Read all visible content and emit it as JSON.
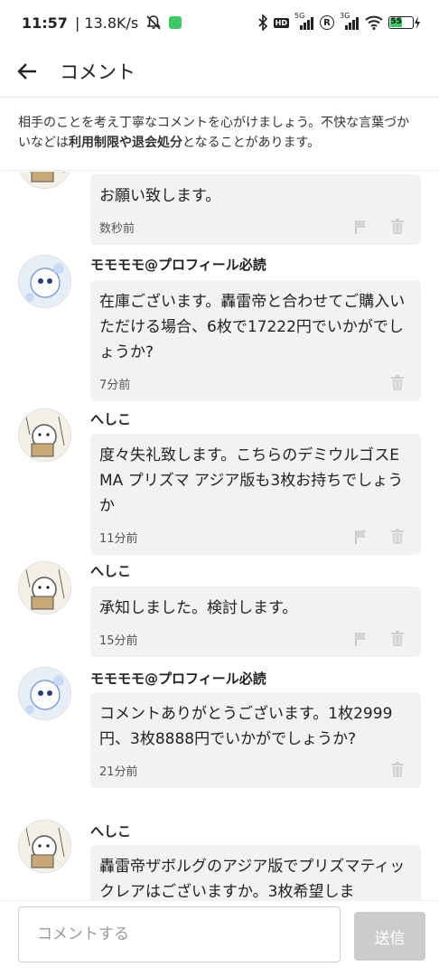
{
  "status_bar": {
    "time": "11:57",
    "speed": "| 13.8K/s",
    "battery": "55",
    "net1": "5G",
    "net2": "3G",
    "hd": "HD",
    "r": "R"
  },
  "header": {
    "title": "コメント"
  },
  "notice": {
    "text_1": "相手のことを考え丁寧なコメントを心がけましょう。不快な言葉づかいなどは",
    "text_bold": "利用制限や退会処分",
    "text_2": "となることがあります。"
  },
  "comments": [
    {
      "author": "",
      "text": "お願い致します。",
      "time": "数秒前",
      "flag": true,
      "delete": true
    },
    {
      "author": "モモモモ@プロフィール必読",
      "text": "在庫ございます。轟雷帝と合わせてご購入いただける場合、6枚で17222円でいかがでしょうか?",
      "time": "7分前",
      "flag": false,
      "delete": true
    },
    {
      "author": "へしこ",
      "text": "度々失礼致します。こちらのデミウルゴスEMA プリズマ アジア版も3枚お持ちでしょうか",
      "time": "11分前",
      "flag": true,
      "delete": true
    },
    {
      "author": "へしこ",
      "text": "承知しました。検討します。",
      "time": "15分前",
      "flag": true,
      "delete": true
    },
    {
      "author": "モモモモ@プロフィール必読",
      "text": "コメントありがとうございます。1枚2999円、3枚8888円でいかがでしょうか?",
      "time": "21分前",
      "flag": false,
      "delete": true
    },
    {
      "author": "へしこ",
      "text": "轟雷帝ザボルグのアジア版でプリズマティックレアはございますか。3枚希望しま",
      "time": "",
      "flag": true,
      "delete": true
    }
  ],
  "input": {
    "placeholder": "コメントする",
    "send_label": "送信"
  },
  "colors": {
    "bubble": "#f2f2f2",
    "send_disabled": "#cccccc",
    "battery": "#3cc864"
  }
}
